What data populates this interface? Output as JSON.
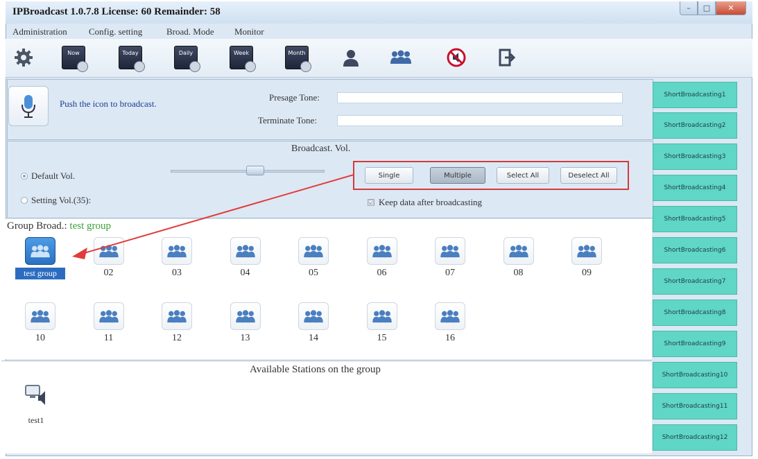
{
  "window": {
    "title": "IPBroadcast 1.0.7.8 License: 60 Remainder: 58",
    "controls": {
      "minimize": "–",
      "maximize": "□",
      "close": "✕"
    }
  },
  "menu": [
    "Administration",
    "Config. setting",
    "Broad. Mode",
    "Monitor"
  ],
  "toolbar": {
    "buttons": [
      {
        "name": "settings-gear-icon"
      },
      {
        "name": "now-schedule-icon",
        "label": "Now"
      },
      {
        "name": "today-schedule-icon",
        "label": "Today"
      },
      {
        "name": "daily-schedule-icon",
        "label": "Daily"
      },
      {
        "name": "weekly-schedule-icon",
        "label": "Week"
      },
      {
        "name": "monthly-schedule-icon",
        "label": "Month"
      },
      {
        "name": "user-icon"
      },
      {
        "name": "group-icon"
      },
      {
        "name": "stop-broadcast-icon"
      },
      {
        "name": "exit-icon"
      }
    ]
  },
  "broadcast": {
    "push_text": "Push the icon to broadcast.",
    "presage_label": "Presage Tone:",
    "terminate_label": "Terminate Tone:",
    "presage_value": "",
    "terminate_value": ""
  },
  "volume": {
    "title": "Broadcast. Vol.",
    "default_label": "Default Vol.",
    "setting_label": "Setting Vol.(35):",
    "selected": "default"
  },
  "selection": {
    "single": "Single",
    "multiple": "Multiple",
    "select_all": "Select All",
    "deselect_all": "Deselect All",
    "active": "multiple",
    "keep_data_label": "Keep data after broadcasting",
    "keep_data_checked": true
  },
  "group": {
    "header_label": "Group Broad.:",
    "selected_name": "test group",
    "items": [
      "test group",
      "02",
      "03",
      "04",
      "05",
      "06",
      "07",
      "08",
      "09",
      "10",
      "11",
      "12",
      "13",
      "14",
      "15",
      "16"
    ],
    "selected_index": 0
  },
  "stations": {
    "title": "Available Stations on the group",
    "items": [
      "test1"
    ]
  },
  "short_broadcasting": [
    "ShortBroadcasting1",
    "ShortBroadcasting2",
    "ShortBroadcasting3",
    "ShortBroadcasting4",
    "ShortBroadcasting5",
    "ShortBroadcasting6",
    "ShortBroadcasting7",
    "ShortBroadcasting8",
    "ShortBroadcasting9",
    "ShortBroadcasting10",
    "ShortBroadcasting11",
    "ShortBroadcasting12"
  ],
  "colors": {
    "accent_red": "#d23a3a",
    "short_btn": "#5fd6c6",
    "group_name": "#3aa03a",
    "push_text": "#1c3e93"
  }
}
